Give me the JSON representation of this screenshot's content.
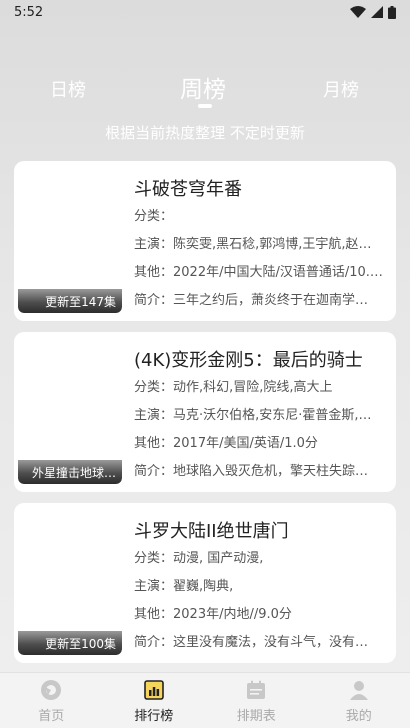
{
  "status": {
    "time": "5:52"
  },
  "tabs": [
    {
      "label": "日榜"
    },
    {
      "label": "周榜"
    },
    {
      "label": "月榜"
    }
  ],
  "subtitle": "根据当前热度整理 不定时更新",
  "cards": [
    {
      "title": "斗破苍穹年番",
      "badge": "更新至147集",
      "category": "分类：",
      "cast": "主演：陈奕雯,黑石稔,郭鸿博,王宇航,赵…",
      "other": "其他：2022年/中国大陆/汉语普通话/10.…",
      "intro": "简介：三年之约后，萧炎终于在迦南学…"
    },
    {
      "title": "(4K)变形金刚5：最后的骑士",
      "badge": "外星撞击地球…",
      "category": "分类：动作,科幻,冒险,院线,高大上",
      "cast": "主演：马克·沃尔伯格,安东尼·霍普金斯,…",
      "other": "其他：2017年/美国/英语/1.0分",
      "intro": "简介：地球陷入毁灭危机，擎天柱失踪…"
    },
    {
      "title": "斗罗大陆II绝世唐门",
      "badge": "更新至100集",
      "category": "分类：动漫, 国产动漫,",
      "cast": "主演：翟巍,陶典,",
      "other": "其他：2023年/内地//9.0分",
      "intro": "简介：这里没有魔法，没有斗气，没有…"
    }
  ],
  "nav": [
    {
      "label": "首页",
      "icon": "home-icon"
    },
    {
      "label": "排行榜",
      "icon": "ranking-icon"
    },
    {
      "label": "排期表",
      "icon": "calendar-icon"
    },
    {
      "label": "我的",
      "icon": "user-icon"
    }
  ]
}
